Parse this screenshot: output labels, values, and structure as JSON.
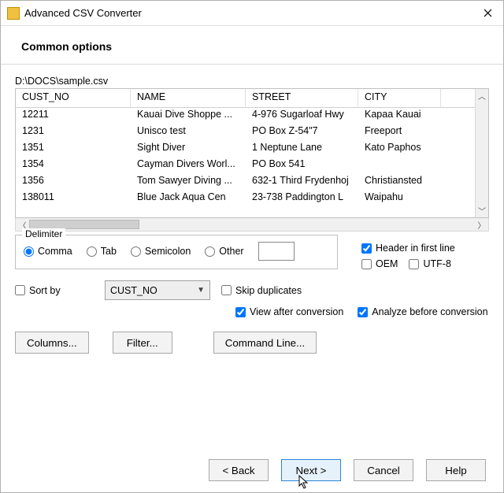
{
  "window": {
    "title": "Advanced CSV Converter"
  },
  "heading": "Common options",
  "file_path": "D:\\DOCS\\sample.csv",
  "table": {
    "columns": [
      "CUST_NO",
      "NAME",
      "STREET",
      "CITY"
    ],
    "rows": [
      [
        "12211",
        " Kauai Dive Shoppe ...",
        "4-976 Sugarloaf Hwy",
        "Kapaa Kauai"
      ],
      [
        "1231",
        "Unisco  test",
        "PO Box Z-54\"7",
        "Freeport"
      ],
      [
        "1351",
        "Sight Diver",
        "1 Neptune Lane",
        "Kato Paphos"
      ],
      [
        "1354",
        "Cayman Divers Worl...",
        "PO Box 541",
        ""
      ],
      [
        "1356",
        "Tom Sawyer Diving ...",
        "632-1 Third Frydenhoj",
        "Christiansted"
      ],
      [
        "138011",
        "Blue Jack Aqua Cen",
        "23-738 Paddington L",
        "Waipahu"
      ]
    ]
  },
  "delimiter": {
    "legend": "Delimiter",
    "options": {
      "comma": "Comma",
      "tab": "Tab",
      "semicolon": "Semicolon",
      "other": "Other"
    },
    "selected": "comma"
  },
  "checks": {
    "header_first_line": {
      "label": "Header in first line",
      "checked": true
    },
    "oem": {
      "label": "OEM",
      "checked": false
    },
    "utf8": {
      "label": "UTF-8",
      "checked": false
    },
    "sort_by": {
      "label": "Sort by",
      "checked": false
    },
    "skip_duplicates": {
      "label": "Skip duplicates",
      "checked": false
    },
    "view_after": {
      "label": "View after conversion",
      "checked": true
    },
    "analyze_before": {
      "label": "Analyze before conversion",
      "checked": true
    }
  },
  "sort_field": "CUST_NO",
  "buttons": {
    "columns": "Columns...",
    "filter": "Filter...",
    "command_line": "Command Line...",
    "back": "< Back",
    "next": "Next >",
    "cancel": "Cancel",
    "help": "Help"
  }
}
